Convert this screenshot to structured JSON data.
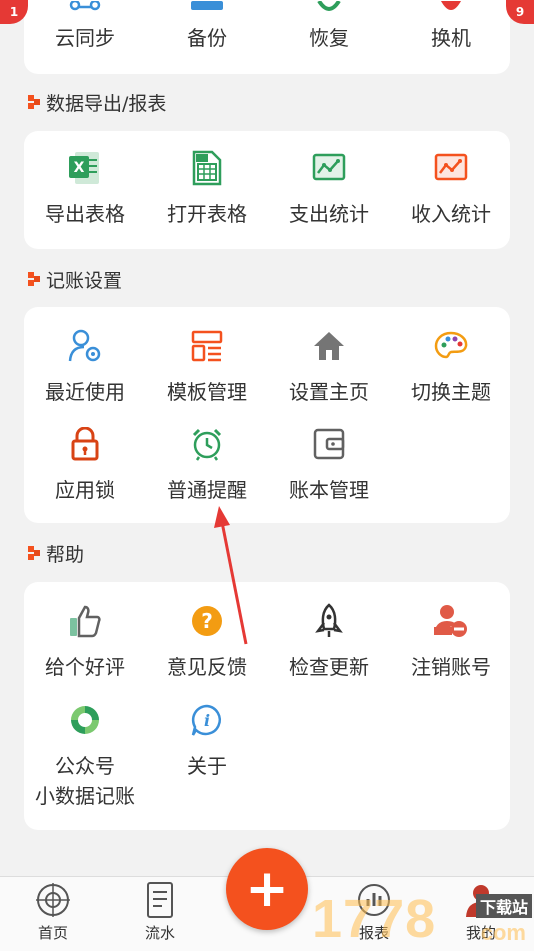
{
  "top_row": {
    "items": [
      {
        "label": "云同步",
        "icon": "cloud-sync-icon"
      },
      {
        "label": "备份",
        "icon": "backup-icon"
      },
      {
        "label": "恢复",
        "icon": "restore-icon"
      },
      {
        "label": "换机",
        "icon": "switch-device-icon"
      }
    ],
    "corner_left": "1",
    "corner_right": "9"
  },
  "sections": {
    "export": {
      "title": "数据导出/报表",
      "items": [
        {
          "label": "导出表格",
          "icon": "excel-icon"
        },
        {
          "label": "打开表格",
          "icon": "spreadsheet-icon"
        },
        {
          "label": "支出统计",
          "icon": "expense-chart-icon"
        },
        {
          "label": "收入统计",
          "icon": "income-chart-icon"
        }
      ]
    },
    "settings": {
      "title": "记账设置",
      "items": [
        {
          "label": "最近使用",
          "icon": "user-gear-icon"
        },
        {
          "label": "模板管理",
          "icon": "template-icon"
        },
        {
          "label": "设置主页",
          "icon": "home-icon"
        },
        {
          "label": "切换主题",
          "icon": "palette-icon"
        },
        {
          "label": "应用锁",
          "icon": "lock-icon"
        },
        {
          "label": "普通提醒",
          "icon": "alarm-clock-icon"
        },
        {
          "label": "账本管理",
          "icon": "wallet-icon"
        }
      ]
    },
    "help": {
      "title": "帮助",
      "items": [
        {
          "label": "给个好评",
          "icon": "thumbs-up-icon"
        },
        {
          "label": "意见反馈",
          "icon": "question-icon"
        },
        {
          "label": "检查更新",
          "icon": "rocket-icon"
        },
        {
          "label": "注销账号",
          "icon": "remove-user-icon"
        },
        {
          "label": "公众号",
          "label2": "小数据记账",
          "icon": "wechat-icon"
        },
        {
          "label": "关于",
          "icon": "info-icon"
        }
      ]
    }
  },
  "bottom_nav": {
    "tabs": [
      {
        "label": "首页",
        "icon": "home-target-icon"
      },
      {
        "label": "流水",
        "icon": "document-icon"
      },
      {
        "label": "报表",
        "icon": "chart-icon"
      },
      {
        "label": "我的",
        "icon": "profile-icon"
      }
    ],
    "fab": "+"
  },
  "watermark": {
    "text": "1778",
    "site": "下载站",
    "sub": "com"
  },
  "colors": {
    "accent": "#f4511e",
    "green": "#2e9e5b",
    "blue": "#3a8fd8",
    "background": "#f2f2f2"
  }
}
